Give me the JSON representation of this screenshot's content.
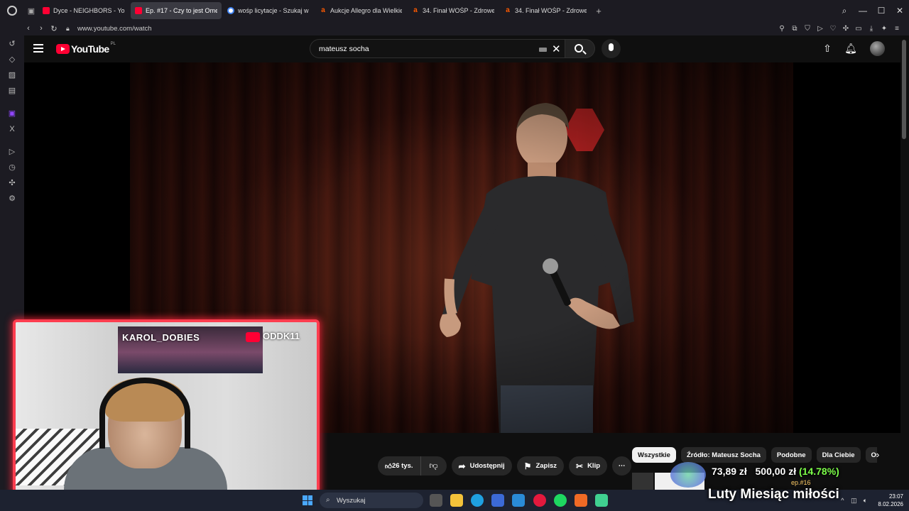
{
  "browser": {
    "tabs": [
      {
        "label": "Dyce - NEIGHBORS - YouT",
        "favicon": "youtube-icon",
        "active": false
      },
      {
        "label": "Ep. #17 - Czy to jest Ome",
        "favicon": "youtube-icon",
        "active": true
      },
      {
        "label": "wośp licytacje - Szukaj w",
        "favicon": "google-icon",
        "active": false
      },
      {
        "label": "Aukcje Allegro dla Wielkie",
        "favicon": "allegro-icon",
        "active": false
      },
      {
        "label": "34. Finał WOŚP - Zdrowe",
        "favicon": "allegro-icon",
        "active": false
      },
      {
        "label": "34. Finał WOŚP - Zdrowe",
        "favicon": "allegro-icon",
        "active": false
      }
    ],
    "url": "www.youtube.com/watch"
  },
  "youtube": {
    "logo_text": "YouTube",
    "region": "PL",
    "search_query": "mateusz socha",
    "actions": {
      "likes": "26 tys.",
      "share": "Udostępnij",
      "save": "Zapisz",
      "clip": "Klip",
      "more": "⋯"
    },
    "chips": [
      "Wszystkie",
      "Źródło: Mateusz Socha",
      "Podobne",
      "Dla Ciebie",
      "Ostat"
    ]
  },
  "stream_overlay": {
    "instagram_handle": "KAROL_DOBIES",
    "youtube_handle": "ODDK11",
    "donation_current": "73,89 zł",
    "donation_goal": "500,00 zł",
    "donation_percent": "(14.78%)",
    "banner": "Luty Miesiąc miłości",
    "thumb_label": "ep.#16"
  },
  "taskbar": {
    "search_placeholder": "Wyszukaj",
    "time": "23:07",
    "date": "8.02.2026"
  },
  "colors": {
    "accent_red": "#ff0033",
    "cam_border": "#ff3d4f",
    "percent_green": "#7dff4a"
  }
}
